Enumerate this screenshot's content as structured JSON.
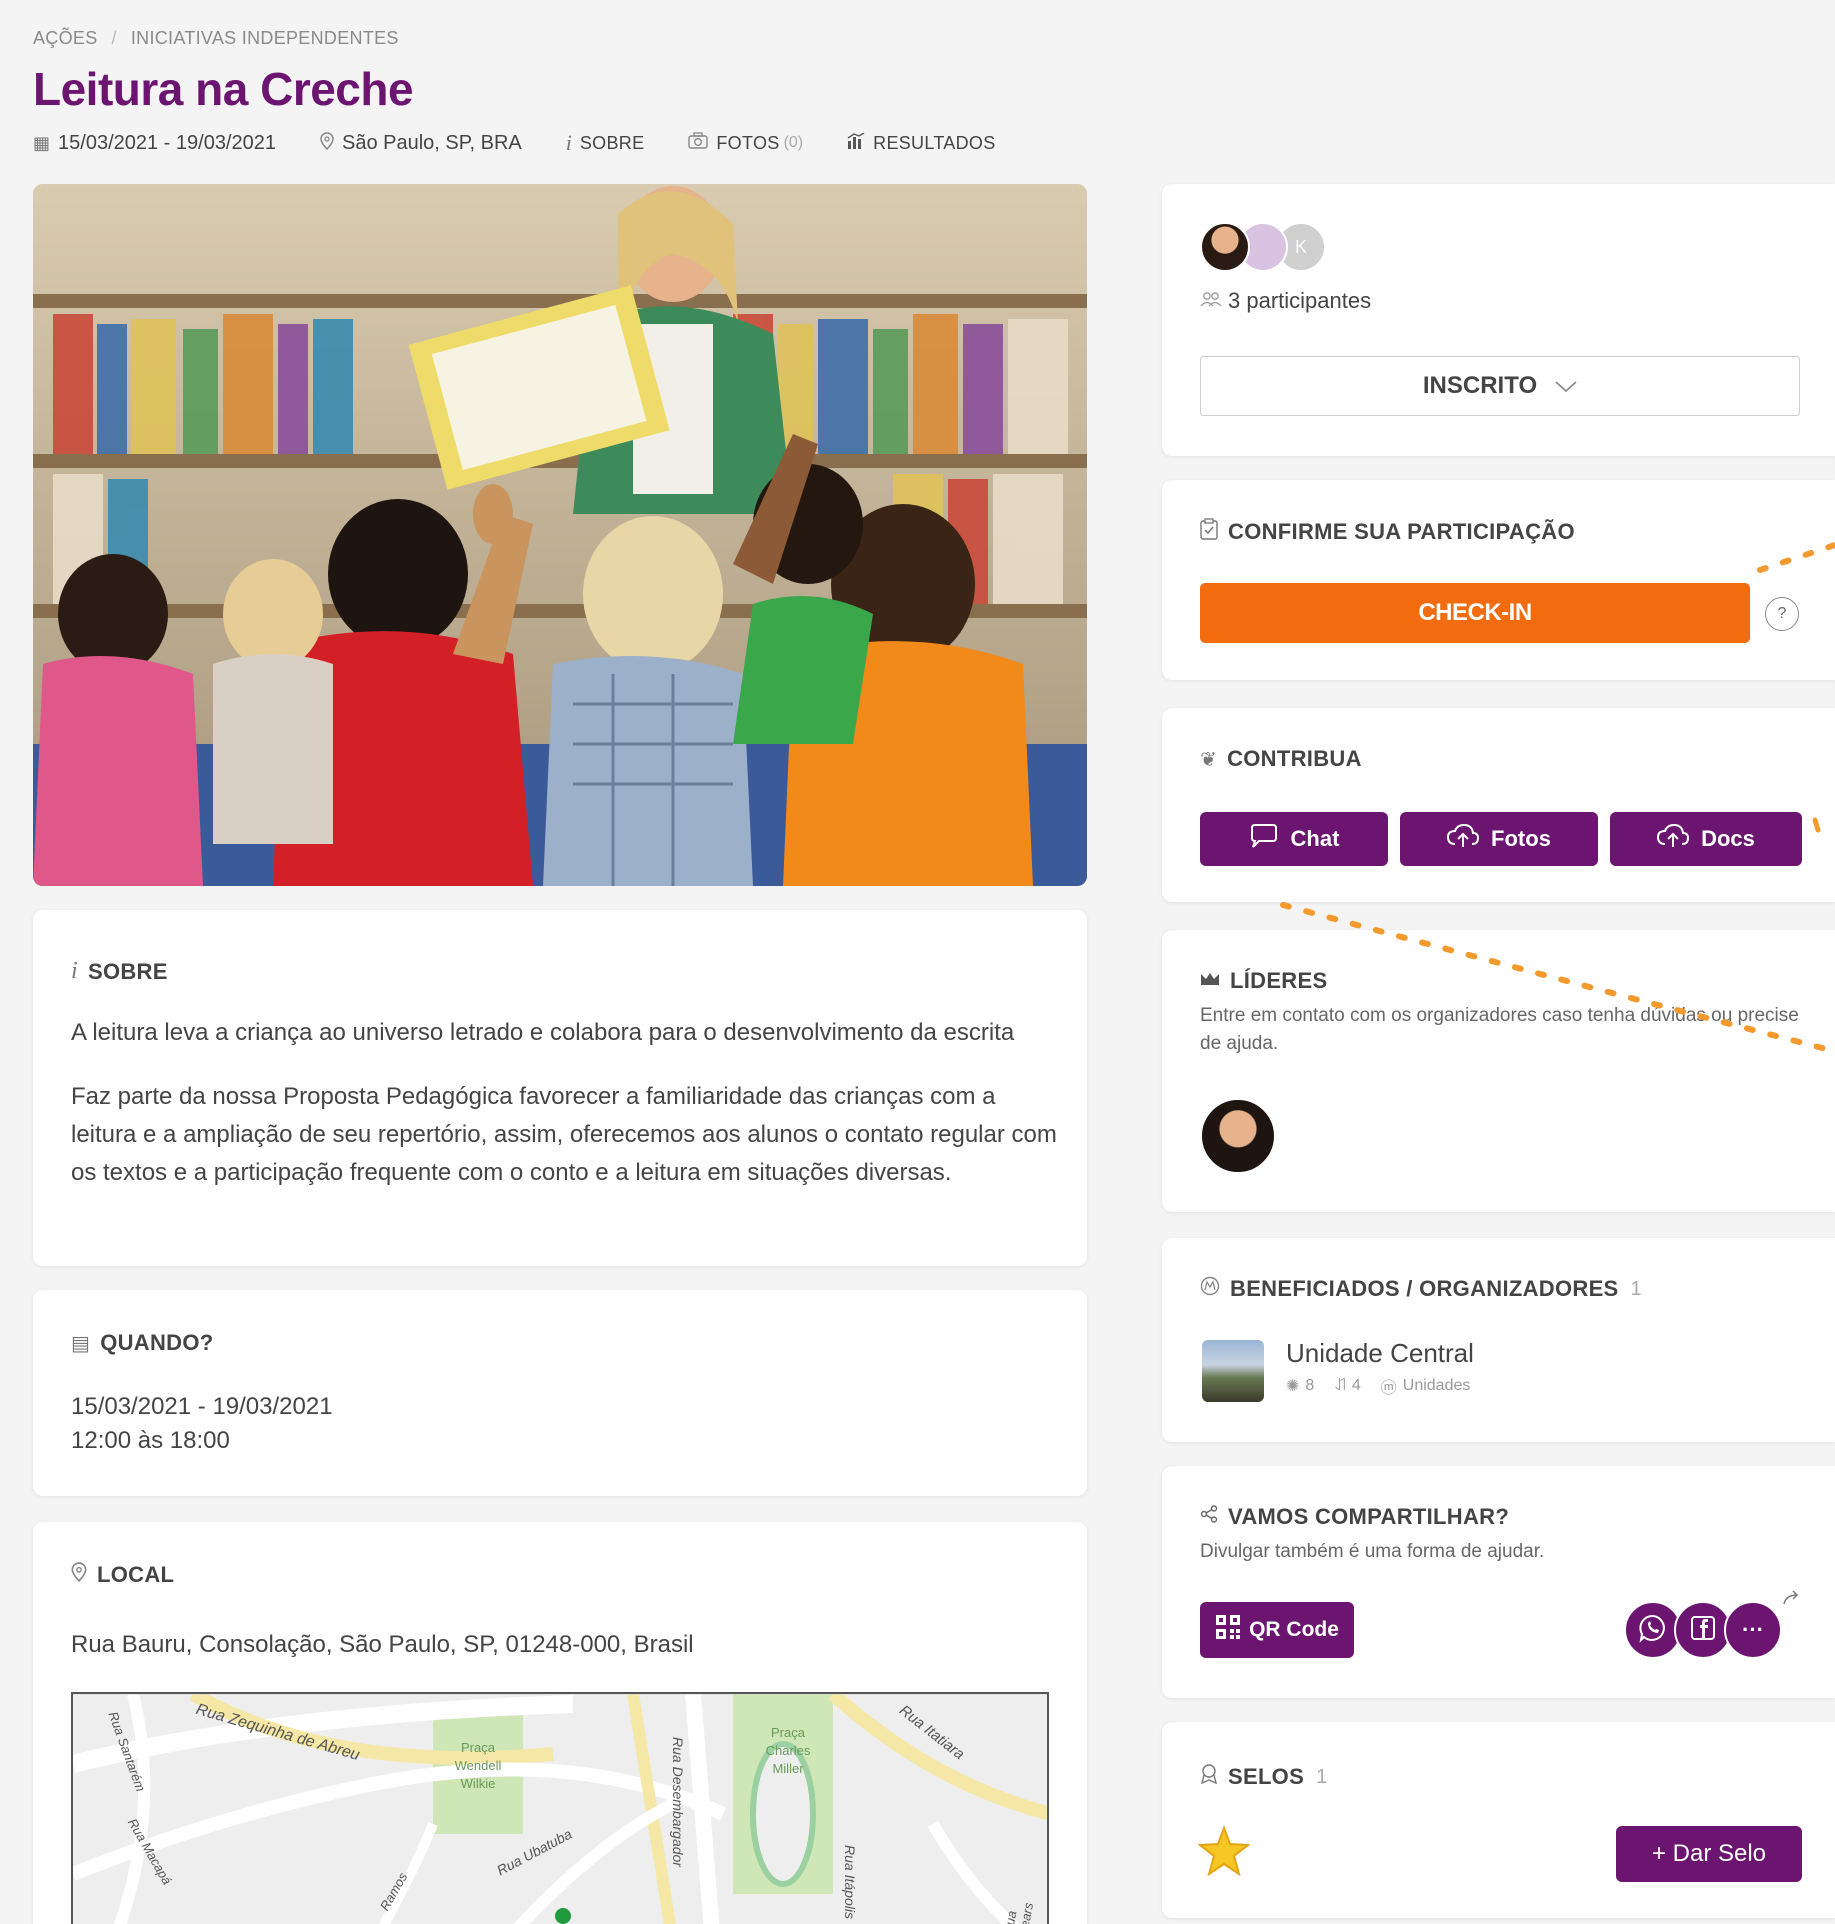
{
  "breadcrumb": {
    "items": [
      "AÇÕES",
      "INICIATIVAS INDEPENDENTES"
    ],
    "separator": "/"
  },
  "title": "Leitura na Creche",
  "meta": {
    "dates": "15/03/2021 - 19/03/2021",
    "location": "São Paulo, SP, BRA",
    "about": "SOBRE",
    "photos": "FOTOS",
    "photos_count": "(0)",
    "results": "RESULTADOS"
  },
  "sobre": {
    "heading": "SOBRE",
    "p1": "A leitura leva a criança ao universo letrado e colabora para o desenvolvimento da escrita",
    "p2": "Faz parte da nossa Proposta Pedagógica favorecer a familiaridade das crianças com a leitura e a ampliação de seu repertório, assim, oferecemos aos alunos o contato regular com os textos e a participação frequente com o conto e a leitura em situações diversas."
  },
  "quando": {
    "heading": "QUANDO?",
    "dates": "15/03/2021 - 19/03/2021",
    "hours": "12:00 às 18:00"
  },
  "local": {
    "heading": "LOCAL",
    "address": "Rua Bauru, Consolação, São Paulo, SP, 01248-000, Brasil",
    "map_labels": [
      "Rua Zequinha de Abreu",
      "Praça Wendell Wilkie",
      "Praça Charles Miller",
      "Rua Itatiara",
      "Rua Ubatuba",
      "Rua Desembargador",
      "Rua Itápolis",
      "Rua Macapá",
      "Rua Santarém",
      "Ramos",
      "Rua Cears"
    ]
  },
  "participants": {
    "count_label": "3 participantes",
    "avatar_initial": "K",
    "status_button": "INSCRITO"
  },
  "checkin": {
    "heading": "CONFIRME SUA PARTICIPAÇÃO",
    "button": "CHECK-IN",
    "help": "?"
  },
  "contribua": {
    "heading": "CONTRIBUA",
    "buttons": [
      "Chat",
      "Fotos",
      "Docs"
    ]
  },
  "lideres": {
    "heading": "LÍDERES",
    "text": "Entre em contato com os organizadores caso tenha dúvidas ou precise de ajuda."
  },
  "beneficiados": {
    "heading": "BENEFICIADOS / ORGANIZADORES",
    "count": "1",
    "org_name": "Unidade Central",
    "stat1": "8",
    "stat2": "4",
    "stat3": "Unidades"
  },
  "share": {
    "heading": "VAMOS COMPARTILHAR?",
    "text": "Divulgar também é uma forma de ajudar.",
    "qr_button": "QR Code",
    "more": "···"
  },
  "selos": {
    "heading": "SELOS",
    "count": "1",
    "give_button": "+ Dar Selo"
  },
  "colors": {
    "purple": "#6b1470",
    "orange": "#f26b0f",
    "dotted": "#f29a2e"
  }
}
